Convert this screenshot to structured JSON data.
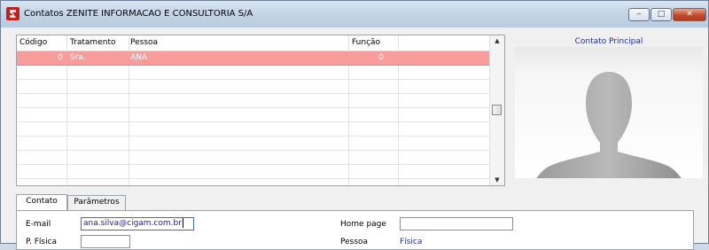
{
  "window": {
    "title": "Contatos ZENITE INFORMACAO E CONSULTORIA S/A",
    "minimize": "‒",
    "maximize": "□",
    "close": "✕"
  },
  "grid": {
    "columns": [
      "Código",
      "Tratamento",
      "Pessoa",
      "Função"
    ],
    "rows": [
      {
        "codigo": "0",
        "tratamento": "Sra.",
        "pessoa": "ANA",
        "funcao": "0"
      }
    ],
    "empty_rows": 9
  },
  "photo": {
    "label": "Contato Principal"
  },
  "tabs": [
    {
      "label": "Contato",
      "active": true
    },
    {
      "label": "Parâmetros",
      "active": false
    }
  ],
  "form": {
    "email_label": "E-mail",
    "email_value": "ana.silva@cigam.com.br",
    "homepage_label": "Home page",
    "homepage_value": "",
    "pfisica_label": "P. Física",
    "pfisica_value": "",
    "pessoa_label": "Pessoa",
    "pessoa_value": "Física"
  }
}
